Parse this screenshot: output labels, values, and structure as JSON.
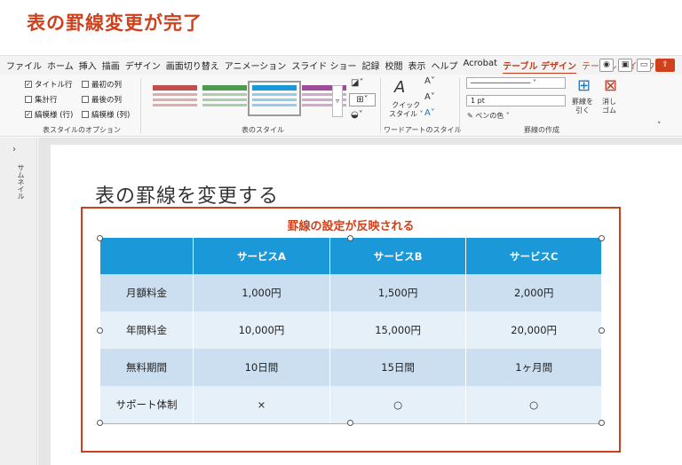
{
  "headline": "表の罫線変更が完了",
  "ribbon": {
    "tabs": [
      {
        "label": "ファイル",
        "type": "normal"
      },
      {
        "label": "ホーム",
        "type": "normal"
      },
      {
        "label": "挿入",
        "type": "normal"
      },
      {
        "label": "描画",
        "type": "normal"
      },
      {
        "label": "デザイン",
        "type": "normal"
      },
      {
        "label": "画面切り替え",
        "type": "normal"
      },
      {
        "label": "アニメーション",
        "type": "normal"
      },
      {
        "label": "スライド ショー",
        "type": "normal"
      },
      {
        "label": "記録",
        "type": "normal"
      },
      {
        "label": "校閲",
        "type": "normal"
      },
      {
        "label": "表示",
        "type": "normal"
      },
      {
        "label": "ヘルプ",
        "type": "normal"
      },
      {
        "label": "Acrobat",
        "type": "normal"
      },
      {
        "label": "テーブル デザイン",
        "type": "active"
      },
      {
        "label": "テーブル レイアウト",
        "type": "ctx"
      }
    ],
    "options": {
      "header_row": {
        "label": "タイトル行",
        "checked": true
      },
      "total_row": {
        "label": "集計行",
        "checked": false
      },
      "banded_rows": {
        "label": "縞模様 (行)",
        "checked": true
      },
      "first_column": {
        "label": "最初の列",
        "checked": false
      },
      "last_column": {
        "label": "最後の列",
        "checked": false
      },
      "banded_columns": {
        "label": "縞模様 (列)",
        "checked": false
      },
      "group_label": "表スタイルのオプション"
    },
    "styles_group_label": "表のスタイル",
    "wordart": {
      "quick_styles": "クイック\nスタイル ˅",
      "group_label": "ワードアートのスタイル"
    },
    "borders": {
      "pen_weight": "1 pt",
      "pen_color": "ペンの色 ˅",
      "draw_border": "罫線を\n引く",
      "eraser": "消し\nゴム",
      "group_label": "罫線の作成"
    },
    "thumb_colors": [
      "#c0504d",
      "#4e9a4f",
      "#1a98d8",
      "#a04a9a"
    ]
  },
  "sidebar": {
    "label": "サムネイル"
  },
  "slide": {
    "title": "表の罫線を変更する",
    "callout": "罫線の設定が反映される",
    "table": {
      "headers": [
        "",
        "サービスA",
        "サービスB",
        "サービスC"
      ],
      "rows": [
        [
          "月額料金",
          "1,000円",
          "1,500円",
          "2,000円"
        ],
        [
          "年間料金",
          "10,000円",
          "15,000円",
          "20,000円"
        ],
        [
          "無料期間",
          "10日間",
          "15日間",
          "1ヶ月間"
        ],
        [
          "サポート体制",
          "×",
          "○",
          "○"
        ]
      ]
    }
  },
  "colors": {
    "accent": "#d0401b",
    "table_header": "#1a98d8",
    "band_dark": "#cbdff0",
    "band_light": "#e6f0f8"
  }
}
